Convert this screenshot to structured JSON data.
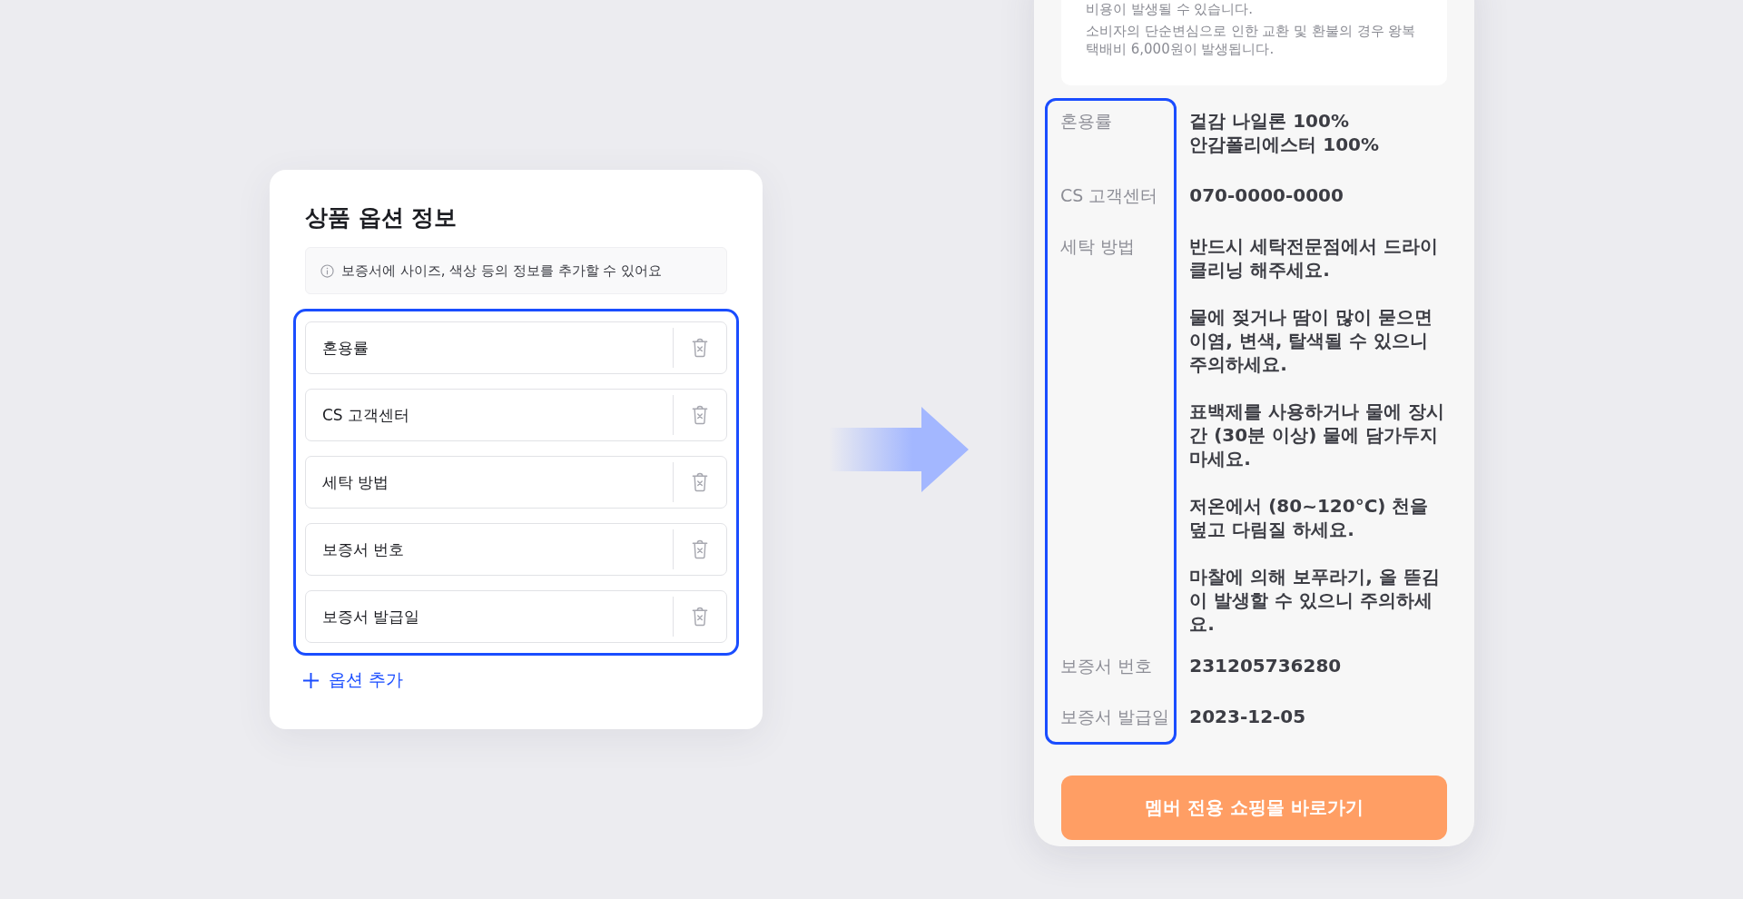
{
  "option_card": {
    "title": "상품 옵션 정보",
    "notice": "보증서에 사이즈, 색상 등의 정보를 추가할 수 있어요",
    "options": [
      {
        "name": "혼용률"
      },
      {
        "name": "CS 고객센터"
      },
      {
        "name": "세탁 방법"
      },
      {
        "name": "보증서 번호"
      },
      {
        "name": "보증서 발급일"
      }
    ],
    "add_button": "옵션 추가"
  },
  "preview": {
    "notice_lines": [
      "비용이 발생될 수 있습니다.",
      "소비자의 단순변심으로 인한 교환 및 환불의 경우 왕복 택배비 6,000원이 발생됩니다."
    ],
    "rows": [
      {
        "label": "혼용률",
        "lines": [
          "겉감 나일론 100%",
          "안감폴리에스터 100%"
        ]
      },
      {
        "label": "CS 고객센터",
        "lines": [
          "070-0000-0000"
        ]
      },
      {
        "label": "세탁 방법",
        "paragraphs": [
          "반드시 세탁전문점에서 드라이 클리닝 해주세요.",
          "물에 젖거나 땀이 많이 묻으면 이염, 변색, 탈색될 수 있으니 주의하세요.",
          "표백제를 사용하거나 물에 장시간 (30분 이상) 물에 담가두지 마세요.",
          "저온에서 (80~120°C) 천을 덮고 다림질 하세요.",
          "마찰에 의해 보푸라기, 올 뜯김이 발생할 수 있으니 주의하세요."
        ]
      },
      {
        "label": "보증서 번호",
        "lines": [
          "231205736280"
        ]
      },
      {
        "label": "보증서 발급일",
        "lines": [
          "2023-12-05"
        ]
      }
    ],
    "button": "멤버 전용 쇼핑몰 바로가기"
  }
}
